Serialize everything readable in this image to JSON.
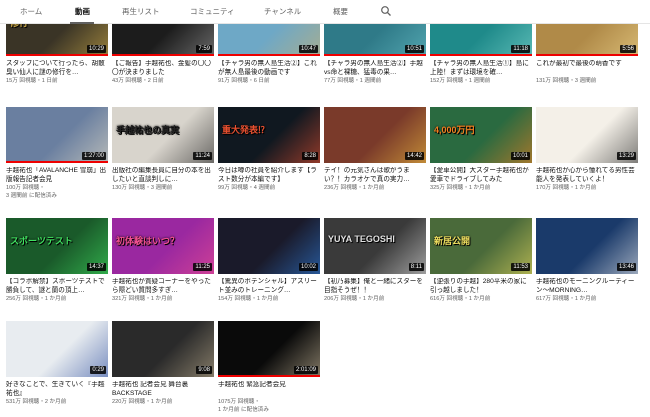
{
  "tabs": [
    {
      "label": "ホーム",
      "active": false
    },
    {
      "label": "動画",
      "active": true
    },
    {
      "label": "再生リスト",
      "active": false
    },
    {
      "label": "コミュニティ",
      "active": false
    },
    {
      "label": "チャンネル",
      "active": false
    },
    {
      "label": "概要",
      "active": false
    }
  ],
  "search_icon": "search-icon",
  "videos": [
    {
      "title": "スタッフについて行ったら、胡散臭い仙人に謎の修行を…",
      "meta": "15万 回視聴・1 日前",
      "duration": "10:29",
      "caption": "修行",
      "bg": "#3a3426",
      "accent": "#d4b04a"
    },
    {
      "title": "【ご報告】手越祐也、金髪の〇〇〇が決まりました",
      "meta": "43万 回視聴・2 日前",
      "duration": "7:59",
      "caption": "",
      "bg": "#1c1c1c",
      "accent": "#9a9a9a"
    },
    {
      "title": "【チャラ男の無人島生活②】これが無人島最後の動画です",
      "meta": "91万 回視聴・6 日前",
      "duration": "10:47",
      "caption": "",
      "bg": "#6ea8c6",
      "accent": "#c8b070"
    },
    {
      "title": "【チャラ男の無人島生活②】手越vs命と裸糖、猛毒の果…",
      "meta": "77万 回視聴・1 週間前",
      "duration": "10:51",
      "caption": "",
      "bg": "#2f7a88",
      "accent": "#68c0c8"
    },
    {
      "title": "【チャラ男の無人島生活①】島に上陸！まずは環境を確…",
      "meta": "152万 回視聴・1 週間前",
      "duration": "11:18",
      "caption": "",
      "bg": "#1f8a8a",
      "accent": "#7fd8d0"
    },
    {
      "title": "これが最初で最後の萌香です",
      "meta": "131万 回視聴・3 週間前",
      "duration": "5:56",
      "caption": "",
      "bg": "#b08a48",
      "accent": "#f0d890"
    },
    {
      "title": "手越祐也「AVALANCHE 雪崩」出版報告記者会見",
      "meta": "100万 回視聴・",
      "meta2": "3 週間前 に配信済み",
      "duration": "1:27:00",
      "caption": "",
      "bg": "#6a7fa0",
      "accent": "#e8e0c8"
    },
    {
      "title": "出版社の編集長員に自分の本を出したいと直談判しに…",
      "meta": "130万 回視聴・3 週間前",
      "duration": "11:24",
      "caption": "手越祐也の真実",
      "bg": "#d8d4cc",
      "accent": "#222222"
    },
    {
      "title": "今日は噂の社員を紹介します【ラスト数分が本編です】",
      "meta": "99万 回視聴・4 週間前",
      "duration": "8:28",
      "caption": "重大発表⁉",
      "bg": "#101820",
      "accent": "#e85030"
    },
    {
      "title": "テイ！の元気さんは歌がうまい？！カラオケで真の実力…",
      "meta": "236万 回視聴・1 か月前",
      "duration": "14:42",
      "caption": "",
      "bg": "#7a3a2a",
      "accent": "#f0c040"
    },
    {
      "title": "【愛車公開】大スター手越祐也が愛車でドライブしてみた",
      "meta": "325万 回視聴・1 か月前",
      "duration": "10:01",
      "caption": "4,000万円",
      "bg": "#2a6a40",
      "accent": "#f08020"
    },
    {
      "title": "手越祐也が心から憧れてる男性芸能人を発表していくよ！",
      "meta": "170万 回視聴・1 か月前",
      "duration": "13:29",
      "caption": "",
      "bg": "#f4f0e8",
      "accent": "#303030"
    },
    {
      "title": "【コラボ解禁】スポーツテストで勝負して、謎と蘭の頂上…",
      "meta": "256万 回視聴・1 か月前",
      "duration": "14:37",
      "caption": "スポーツテスト",
      "bg": "#1a5a2a",
      "accent": "#40e060"
    },
    {
      "title": "手越祐也が質疑コーナーをやったら際どい質問多すぎ…",
      "meta": "321万 回視聴・1 か月前",
      "duration": "11:25",
      "caption": "初体験はいつ？",
      "bg": "#9a28a0",
      "accent": "#f05090"
    },
    {
      "title": "【驚異のポテンシャル】アスリート並みのトレーニング…",
      "meta": "154万 回視聴・1 か月前",
      "duration": "10:02",
      "caption": "",
      "bg": "#1a1a2a",
      "accent": "#3080e0"
    },
    {
      "title": "【初乃募集】俺と一緒にスターを目指そうぜ！！",
      "meta": "206万 回視聴・1 か月前",
      "duration": "8:11",
      "caption": "YUYA TEGOSHI",
      "bg": "#3a3a3a",
      "accent": "#e0e0e0"
    },
    {
      "title": "【逆張りの手越】280平米の家に引っ越しました！",
      "meta": "616万 回視聴・1 か月前",
      "duration": "11:53",
      "caption": "新居公開",
      "bg": "#4a6a3a",
      "accent": "#f0e060"
    },
    {
      "title": "手越祐也のモーニングルーティーン〜MORNING…",
      "meta": "617万 回視聴・1 か月前",
      "duration": "13:46",
      "caption": "",
      "bg": "#1a3a6a",
      "accent": "#f0f0f0"
    },
    {
      "title": "好きなことで、生きていく『手越祐也』",
      "meta": "531万 回視聴・2 か月前",
      "duration": "0:29",
      "caption": "",
      "bg": "#e8ecf0",
      "accent": "#3050a0"
    },
    {
      "title": "手越祐也 記者会見 舞台裏 BACKSTAGE",
      "meta": "220万 回視聴・1 か月前",
      "duration": "9:08",
      "caption": "",
      "bg": "#2a2a2a",
      "accent": "#c0b090"
    },
    {
      "title": "手越祐也 緊急記者会見",
      "meta": "1075万 回視聴・",
      "meta2": "1 か月前 に配信済み",
      "duration": "2:01:09",
      "caption": "",
      "bg": "#0a0a0a",
      "accent": "#d0c0a0"
    }
  ]
}
